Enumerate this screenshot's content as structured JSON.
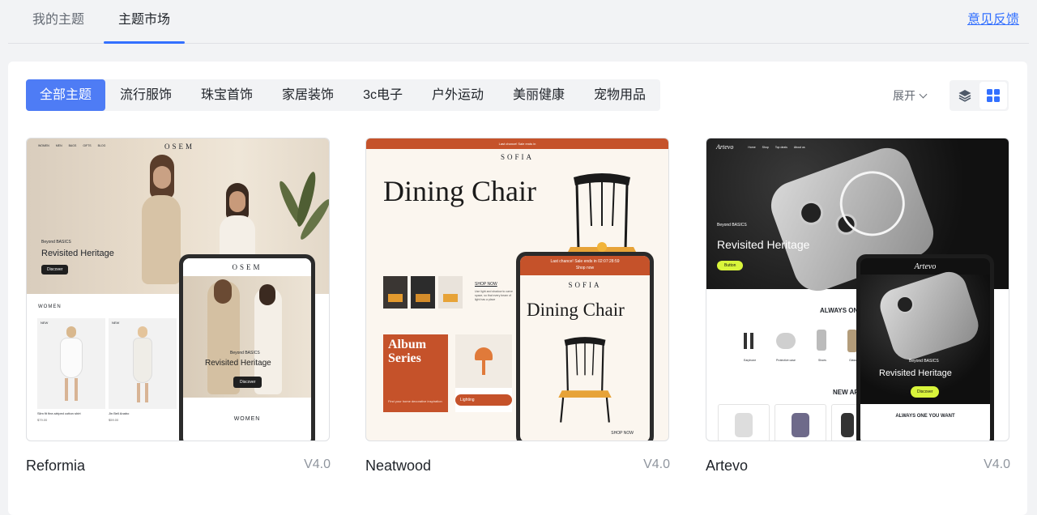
{
  "top_tabs": [
    {
      "label": "我的主题"
    },
    {
      "label": "主题市场"
    }
  ],
  "feedback_link": "意见反馈",
  "categories": [
    "全部主题",
    "流行服饰",
    "珠宝首饰",
    "家居装饰",
    "3c电子",
    "户外运动",
    "美丽健康",
    "宠物用品"
  ],
  "expand_label": "展开",
  "colors": {
    "accent": "#3370ff",
    "category_active": "#4e7cf5"
  },
  "themes": [
    {
      "name": "Reformia",
      "version": "V4.0",
      "preview": {
        "brand": "OSEM",
        "hero_kicker": "Beyond BASICS",
        "hero_title": "Revisited Heritage",
        "cta": "Discover",
        "section": "WOMEN",
        "device_brand": "OSEM",
        "device_kicker": "Beyond BASICS",
        "device_title": "Revisited Heritage",
        "device_cta": "Discover",
        "device_section": "WOMEN",
        "badge": "NEW",
        "product1": "Slim fit fine-striped cotton shirt",
        "product2": "Jin Bell Anabo",
        "price1": "$79.00",
        "price2": "$59.00",
        "nav_items": [
          "WOMEN",
          "MEN",
          "BAGS",
          "GIFTS",
          "BLOG"
        ]
      }
    },
    {
      "name": "Neatwood",
      "version": "V4.0",
      "preview": {
        "announcement": "Last chance! Sale ends in",
        "brand": "SOFIA",
        "hero_title": "Dining Chair",
        "shop_now": "SHOP NOW",
        "shop_desc": "Use light and shadow to carve space, so that every beam of light has a place",
        "album_title": "Album Series",
        "album_desc": "Find your home decorative inspiration",
        "lighting": "Lighting",
        "device_announcement": "Last chance! Sale ends in 02:07:28:59",
        "device_shop": "Shop now",
        "device_brand": "SOFIA",
        "device_title": "Dining Chair",
        "device_shop_now": "SHOP NOW"
      }
    },
    {
      "name": "Artevo",
      "version": "V4.0",
      "preview": {
        "brand": "Artevo",
        "nav_items": [
          "Home",
          "Shop",
          "Top deals",
          "About us"
        ],
        "hero_kicker": "Beyond BASICS",
        "hero_title": "Revisited Heritage",
        "cta": "Button",
        "section": "ALWAYS ON",
        "section2": "NEW AR",
        "products": [
          "Earphone",
          "Protective case",
          "Shoes",
          "Glass"
        ],
        "device_brand": "Artevo",
        "device_kicker": "Beyond BASICS",
        "device_title": "Revisited Heritage",
        "device_cta": "Discover",
        "device_section": "ALWAYS ONE YOU WANT"
      }
    }
  ]
}
